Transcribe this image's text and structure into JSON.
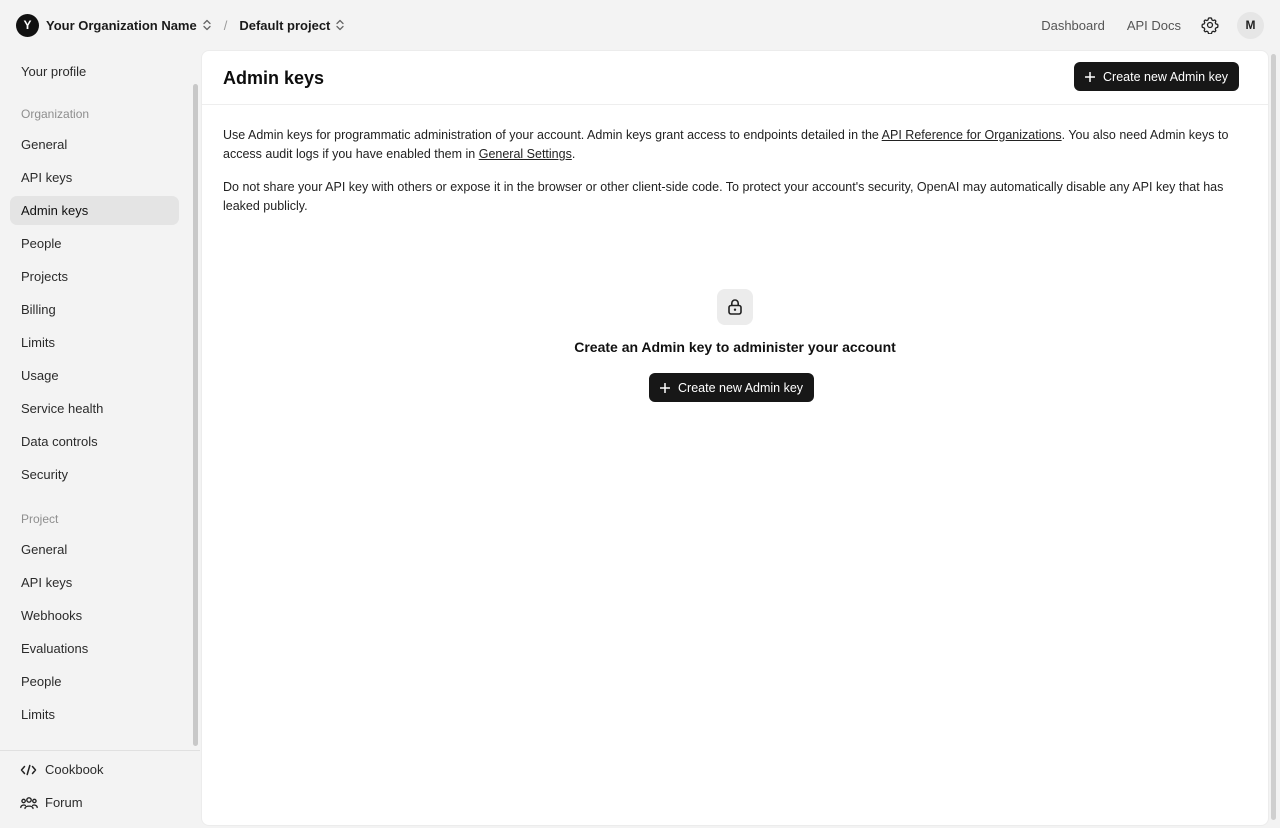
{
  "topbar": {
    "org_initial": "Y",
    "org_name": "Your Organization Name",
    "separator": "/",
    "project_name": "Default project",
    "links": {
      "dashboard": "Dashboard",
      "api_docs": "API Docs"
    },
    "user_initial": "M"
  },
  "sidebar": {
    "profile": "Your profile",
    "org_section": "Organization",
    "org_items": [
      "General",
      "API keys",
      "Admin keys",
      "People",
      "Projects",
      "Billing",
      "Limits",
      "Usage",
      "Service health",
      "Data controls",
      "Security"
    ],
    "active_item": "Admin keys",
    "project_section": "Project",
    "project_items": [
      "General",
      "API keys",
      "Webhooks",
      "Evaluations",
      "People",
      "Limits"
    ],
    "footer": {
      "cookbook": "Cookbook",
      "forum": "Forum"
    }
  },
  "main": {
    "title": "Admin keys",
    "create_button": "Create new Admin key",
    "desc1": {
      "part1": "Use Admin keys for programmatic administration of your account. Admin keys grant access to endpoints detailed in the ",
      "link1": "API Reference for Organizations",
      "part2": ". You also need Admin keys to access audit logs if you have enabled them in ",
      "link2": "General Settings",
      "part3": "."
    },
    "desc2": "Do not share your API key with others or expose it in the browser or other client-side code. To protect your account's security, OpenAI may automatically disable any API key that has leaked publicly.",
    "empty": {
      "icon": "lock-icon",
      "title": "Create an Admin key to administer your account",
      "button": "Create new Admin key"
    }
  },
  "colors": {
    "accent": "#171717",
    "active_nav_bg": "#e4e4e4",
    "page_bg": "#f3f3f3"
  }
}
